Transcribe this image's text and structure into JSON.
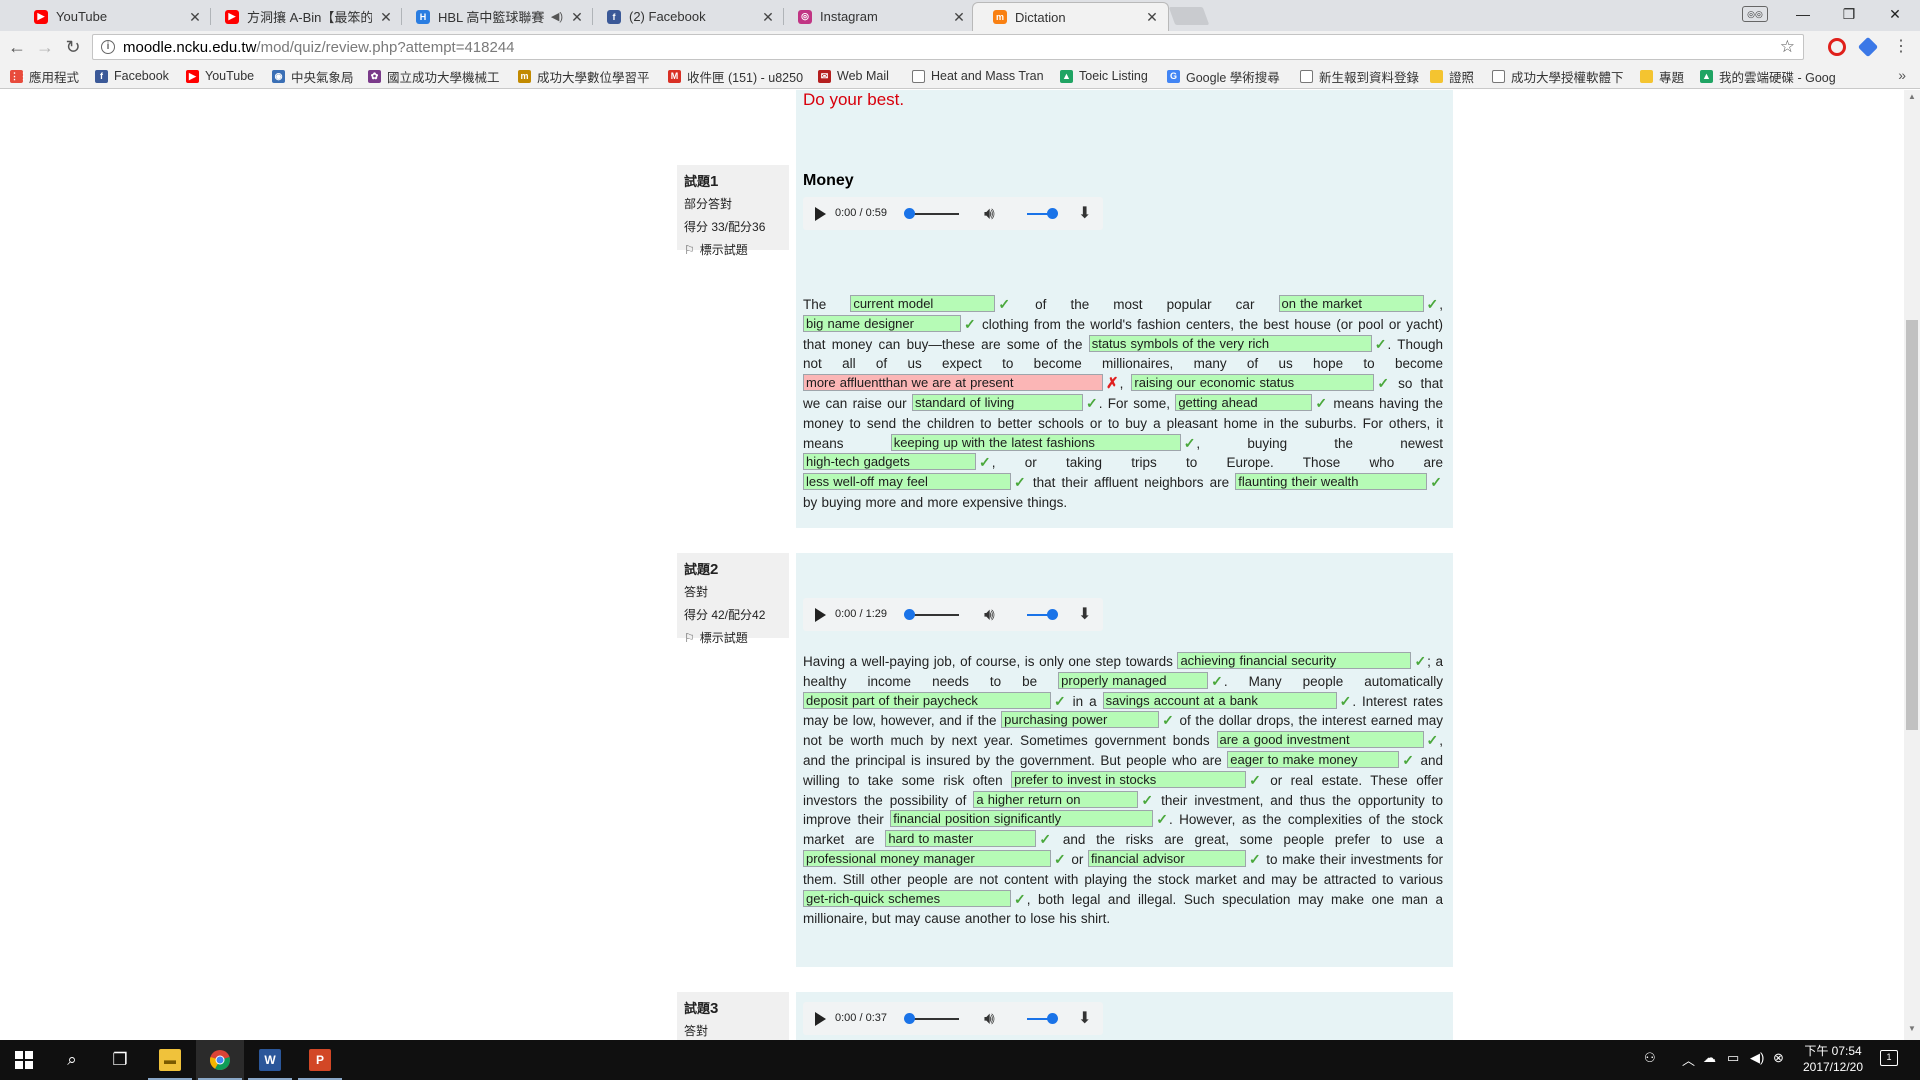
{
  "browser": {
    "tabs": [
      {
        "title": "YouTube",
        "icon": "youtube-icon",
        "color": "#ff0000"
      },
      {
        "title": "方洞攘 A-Bin【最笨的人",
        "icon": "youtube-icon",
        "color": "#ff0000"
      },
      {
        "title": "HBL 高中籃球聯賽 - ",
        "icon": "hbl-icon",
        "color": "#2a7de1",
        "audio": "◀)"
      },
      {
        "title": "(2) Facebook",
        "icon": "facebook-icon",
        "color": "#3b5998"
      },
      {
        "title": "Instagram",
        "icon": "instagram-icon",
        "color": "#c13584"
      },
      {
        "title": "Dictation",
        "icon": "moodle-icon",
        "color": "#f98012"
      }
    ],
    "url_host": "moodle.ncku.edu.tw",
    "url_path": "/mod/quiz/review.php?attempt=418244",
    "bookmarks": [
      {
        "label": "應用程式",
        "icon": "apps-grid-icon",
        "color": "#e84b3c"
      },
      {
        "label": "Facebook",
        "icon": "facebook-icon",
        "color": "#3b5998"
      },
      {
        "label": "YouTube",
        "icon": "youtube-icon",
        "color": "#ff0000"
      },
      {
        "label": "中央氣象局",
        "icon": "cwb-icon",
        "color": "#3a6fb5"
      },
      {
        "label": "國立成功大學機械工",
        "icon": "ncku-icon",
        "color": "#7a3a8a"
      },
      {
        "label": "成功大學數位學習平",
        "icon": "m-icon",
        "color": "#c28a00"
      },
      {
        "label": "收件匣 (151) - u8250",
        "icon": "gmail-icon",
        "color": "#d93025"
      },
      {
        "label": "Web Mail",
        "icon": "webmail-icon",
        "color": "#b51f1f"
      },
      {
        "label": "Heat and Mass Tran",
        "icon": "page-icon",
        "color": "#777777"
      },
      {
        "label": "Toeic Listing",
        "icon": "drive-icon",
        "color": "#1fa463"
      },
      {
        "label": "Google 學術搜尋",
        "icon": "scholar-icon",
        "color": "#4285f4"
      },
      {
        "label": "新生報到資料登錄",
        "icon": "page-icon",
        "color": "#777777"
      },
      {
        "label": "證照",
        "icon": "folder-icon",
        "color": "#f4c430"
      },
      {
        "label": "成功大學授權軟體下",
        "icon": "page-icon",
        "color": "#777777"
      },
      {
        "label": "專題",
        "icon": "folder-icon",
        "color": "#f4c430"
      },
      {
        "label": "我的雲端硬碟 - Goog",
        "icon": "drive-icon",
        "color": "#1fa463"
      }
    ]
  },
  "intro": {
    "text": "Do your best."
  },
  "questions": [
    {
      "num_label": "試題",
      "num": "1",
      "state": "部分答對",
      "grade": "得分 33/配分36",
      "flag_label": "標示試題",
      "title": "Money",
      "player": {
        "time": "0:00 / 0:59"
      },
      "text": {
        "p0": "The ",
        "a1": "current model",
        "p1": " of the most popular car ",
        "a2": "on the market",
        "p2": ", ",
        "a3": "big name designer",
        "p3": " clothing from the world's fashion centers, the best house (or pool or yacht) that money can buy—these are some of the ",
        "a4": "status symbols of the very rich",
        "p4": ". Though not all of us expect to become millionaires, many of us hope to become ",
        "a5": "more affluentthan we are at present",
        "p5": ", ",
        "a6": "raising our economic status",
        "p6": " so that we can raise our ",
        "a7": "standard of living",
        "p7": ". For some, ",
        "a8": "getting ahead",
        "p8": " means having the money to send the children to better schools or to buy a pleasant home in the suburbs. For others, it means ",
        "a9": "keeping up with the latest fashions",
        "p9": ", buying the newest ",
        "a10": "high-tech gadgets",
        "p10": ", or taking trips to Europe. Those who are ",
        "a11": "less well-off may feel",
        "p11": " that their affluent neighbors are ",
        "a12": "flaunting their wealth",
        "p12": " by buying more and more expensive things."
      }
    },
    {
      "num_label": "試題",
      "num": "2",
      "state": "答對",
      "grade": "得分 42/配分42",
      "flag_label": "標示試題",
      "player": {
        "time": "0:00 / 1:29"
      },
      "text": {
        "p0": "Having a well-paying job, of course, is only one step towards ",
        "a1": "achieving financial security",
        "p1": "; a healthy income needs to be ",
        "a2": "properly managed",
        "p2": ". Many people automatically ",
        "a3": "deposit part of their paycheck",
        "p3": " in a ",
        "a4": "savings account at a bank",
        "p4": ". Interest rates may be low, however, and if the ",
        "a5": "purchasing power",
        "p5": " of the dollar drops, the interest earned may not be worth much by next year. Sometimes government bonds ",
        "a6": "are a good investment",
        "p6": ", and the principal is insured by the government. But people who are ",
        "a7": "eager to make money",
        "p7": " and willing to take some risk often ",
        "a8": "prefer to invest in stocks",
        "p8": " or real estate. These offer investors the possibility of ",
        "a9": "a higher return on",
        "p9": " their investment, and thus the opportunity to improve their ",
        "a10": "financial position significantly",
        "p10": ". However, as the complexities of the stock market are ",
        "a11": "hard to master",
        "p11": " and the risks are great, some people prefer to use a ",
        "a12": "professional money manager",
        "p12": " or ",
        "a13": "financial advisor",
        "p13": " to make their investments for them. Still other people are not content with playing the stock market and may be attracted to various ",
        "a14": "get-rich-quick schemes",
        "p14": ", both legal and illegal. Such speculation may make one man a millionaire, but may cause another to lose his shirt."
      }
    },
    {
      "num_label": "試題",
      "num": "3",
      "state": "答對",
      "player": {
        "time": "0:00 / 0:37"
      }
    }
  ],
  "taskbar": {
    "clock_time": "下午 07:54",
    "clock_date": "2017/12/20",
    "notification_count": "1",
    "apps": [
      "start-icon",
      "search-icon",
      "task-view-icon",
      "file-explorer-icon",
      "chrome-icon",
      "word-icon",
      "powerpoint-icon"
    ]
  }
}
